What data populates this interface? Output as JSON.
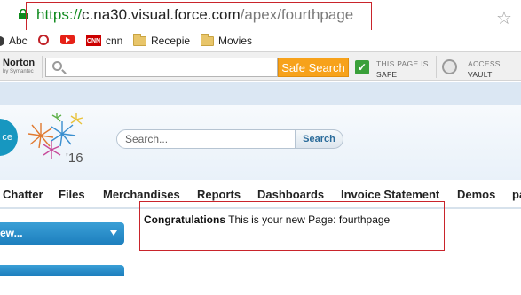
{
  "browser": {
    "url_scheme": "https://",
    "url_host": "c.na30.visual.force.com",
    "url_path": "/apex/fourthpage"
  },
  "bookmarks": [
    {
      "label": "Abc",
      "icon": "dot-icon"
    },
    {
      "label": "",
      "icon": "c-icon"
    },
    {
      "label": "",
      "icon": "youtube-icon"
    },
    {
      "label": "cnn",
      "icon": "cnn-icon"
    },
    {
      "label": "Recepie",
      "icon": "folder-icon"
    },
    {
      "label": "Movies",
      "icon": "folder-icon"
    }
  ],
  "norton": {
    "logo": "Norton",
    "logo_sub": "by Symantec",
    "search_button": "Safe Search",
    "status_line1": "THIS PAGE IS",
    "status_line2": "SAFE",
    "vault_line1": "ACCESS",
    "vault_line2": "VAULT"
  },
  "sf": {
    "logo_text": "ce",
    "year": "'16",
    "search_placeholder": "Search...",
    "search_button": "Search"
  },
  "tabs": [
    {
      "label": "Chatter"
    },
    {
      "label": "Files"
    },
    {
      "label": "Merchandises"
    },
    {
      "label": "Reports"
    },
    {
      "label": "Dashboards"
    },
    {
      "label": "Invoice Statement"
    },
    {
      "label": "Demos"
    },
    {
      "label": "pa"
    }
  ],
  "sidebar": {
    "create_new": "ew..."
  },
  "content": {
    "heading": "Congratulations",
    "message": " This is your new Page: fourthpage"
  },
  "colors": {
    "norton_button": "#f7a21b",
    "sf_blue": "#1797c0",
    "highlight_red": "#c9242b",
    "url_green": "#0f8a1e"
  }
}
